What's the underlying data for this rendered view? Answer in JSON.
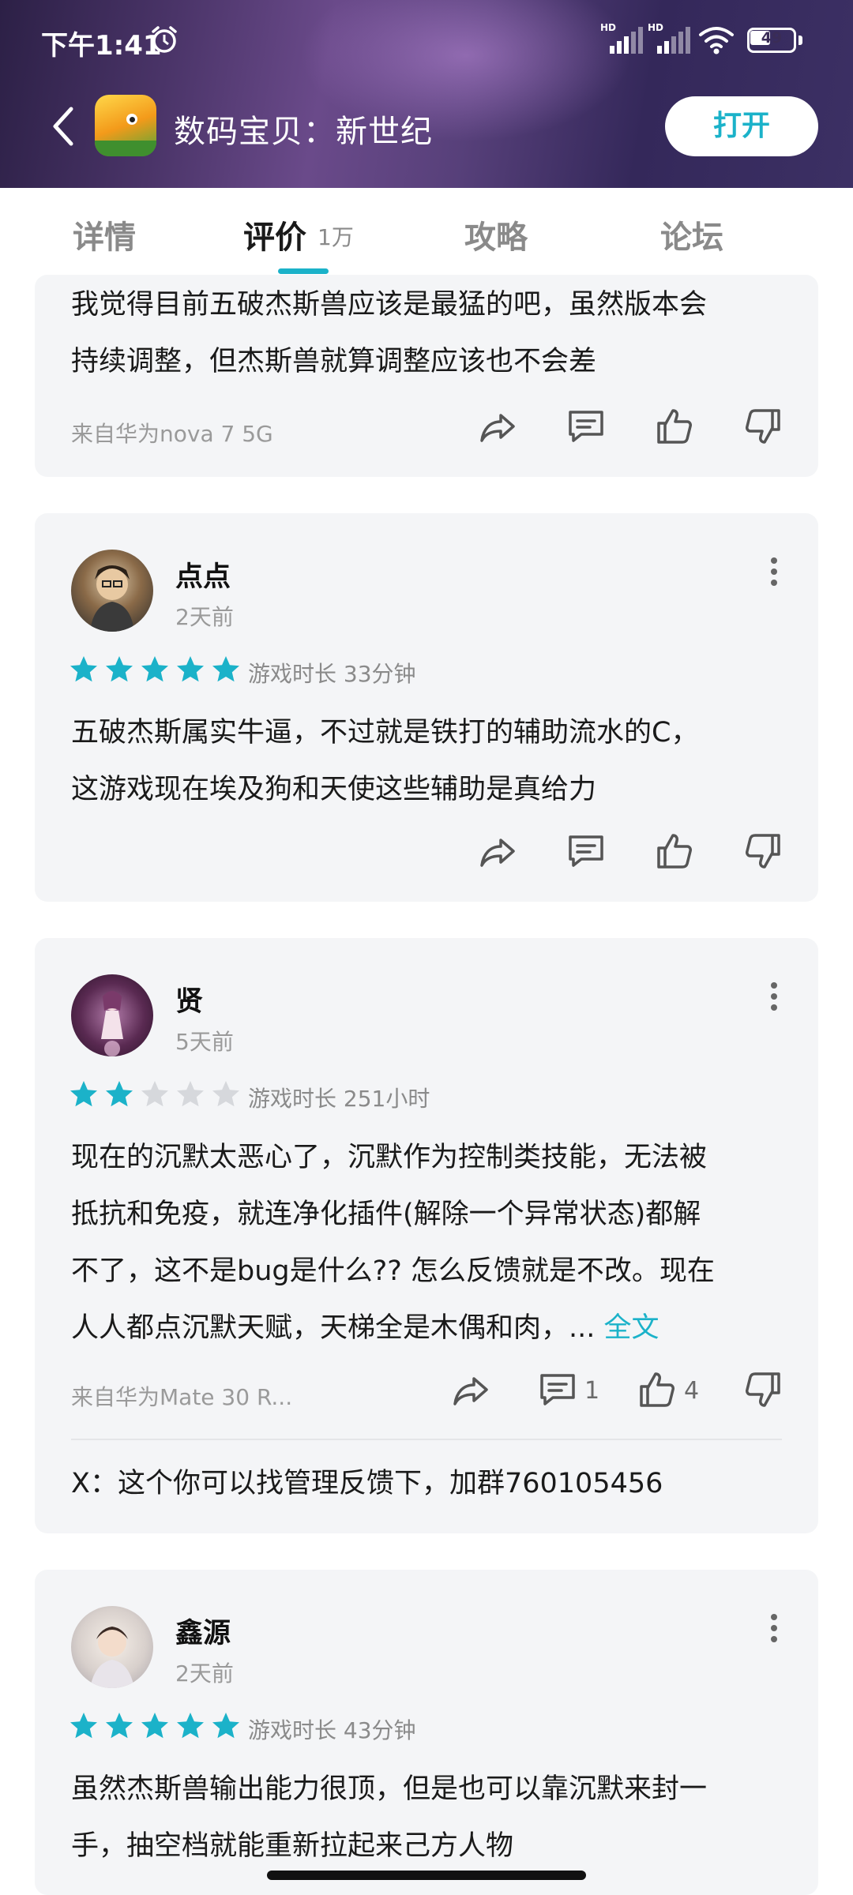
{
  "status": {
    "time": "下午1:41",
    "hd1": "HD",
    "hd2": "HD",
    "battery": "49",
    "battery_level": 0.49
  },
  "header": {
    "app_title": "数码宝贝：新世纪",
    "open_label": "打开"
  },
  "tabs": [
    {
      "label": "详情"
    },
    {
      "label": "评价",
      "count": "1万"
    },
    {
      "label": "攻略"
    },
    {
      "label": "论坛"
    }
  ],
  "colors": {
    "accent": "#1bb2c9",
    "star_empty": "#d6d8dc"
  },
  "reviews": [
    {
      "text_lines": [
        "我觉得目前五破杰斯兽应该是最猛的吧，虽然版本会",
        "持续调整，但杰斯兽就算调整应该也不会差"
      ],
      "source": "来自华为nova 7 5G"
    },
    {
      "username": "点点",
      "time_ago": "2天前",
      "rating": 5,
      "playtime": "游戏时长 33分钟",
      "text_lines": [
        "五破杰斯属实牛逼，不过就是铁打的辅助流水的C，",
        "这游戏现在埃及狗和天使这些辅助是真给力"
      ]
    },
    {
      "username": "贤",
      "time_ago": "5天前",
      "rating": 2,
      "playtime": "游戏时长 251小时",
      "text_lines": [
        "现在的沉默太恶心了，沉默作为控制类技能，无法被",
        "抵抗和免疫，就连净化插件(解除一个异常状态)都解",
        "不了，这不是bug是什么?? 怎么反馈就是不改。现在",
        "人人都点沉默天赋，天梯全是木偶和肉，... "
      ],
      "fulltext": "全文",
      "source": "来自华为Mate 30 R...",
      "comment_count": "1",
      "like_count": "4",
      "reply": "X：这个你可以找管理反馈下，加群760105456"
    },
    {
      "username": "鑫源",
      "time_ago": "2天前",
      "rating": 5,
      "playtime": "游戏时长 43分钟",
      "text_lines": [
        "虽然杰斯兽输出能力很顶，但是也可以靠沉默来封一",
        "手，抽空档就能重新拉起来己方人物"
      ]
    }
  ]
}
